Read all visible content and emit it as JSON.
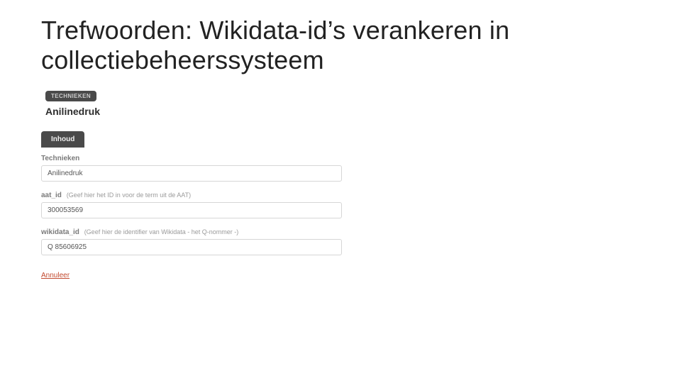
{
  "title": "Trefwoorden: Wikidata-id’s verankeren in collectiebeheerssysteem",
  "record": {
    "badge": "TECHNIEKEN",
    "name": "Anilinedruk"
  },
  "tabs": {
    "active": "Inhoud"
  },
  "fields": {
    "technieken": {
      "label": "Technieken",
      "value": "Anilinedruk"
    },
    "aat": {
      "label": "aat_id",
      "hint": "(Geef hier het ID in voor de term uit de AAT)",
      "value": "300053569"
    },
    "wikidata": {
      "label": "wikidata_id",
      "hint": "(Geef hier de identifier van Wikidata - het Q-nommer -)",
      "value": "Q 85606925"
    }
  },
  "actions": {
    "cancel": "Annuleer"
  }
}
